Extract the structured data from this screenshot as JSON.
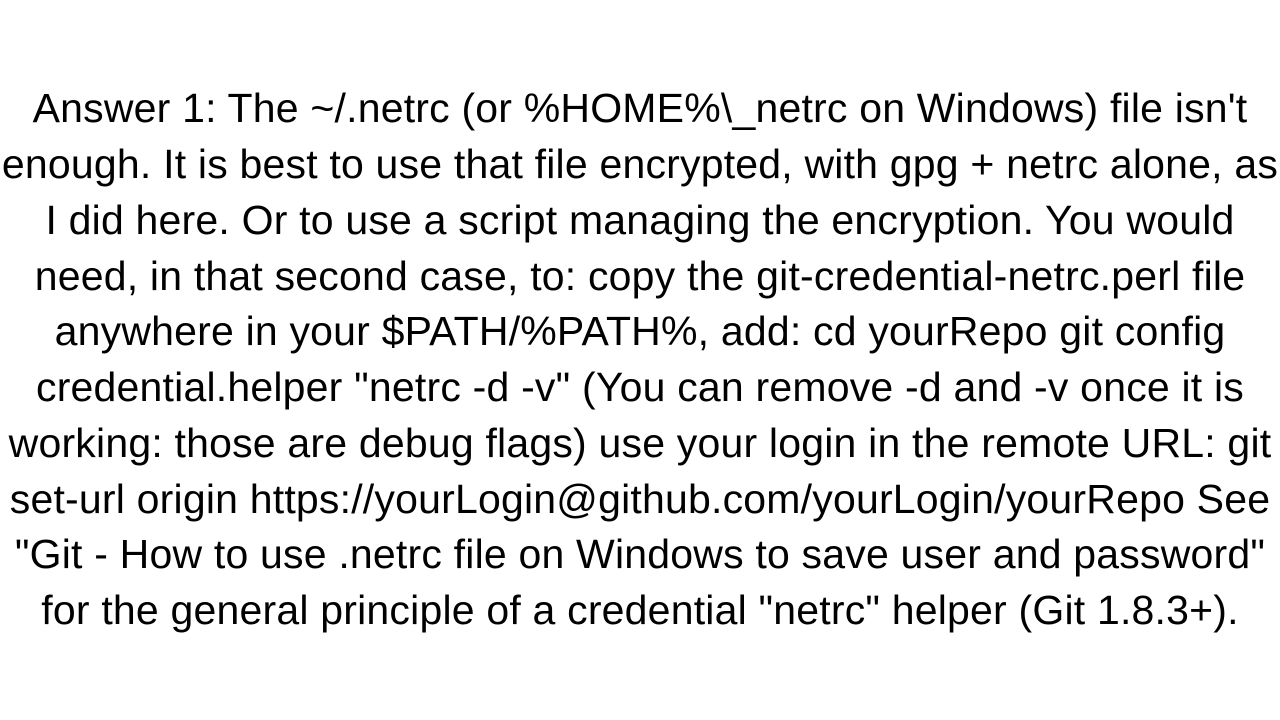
{
  "answer": {
    "text": "Answer 1: The ~/.netrc (or %HOME%\\_netrc on Windows) file isn't enough. It is best to use that file encrypted, with gpg + netrc alone, as I did here. Or to use a script managing the encryption. You would need, in that second case, to:  copy the git-credential-netrc.perl file anywhere in your $PATH/%PATH%,  add:   cd yourRepo   git config credential.helper \"netrc -d -v\"    (You can remove -d and -v once it is working: those are debug flags)  use your login in the remote URL:   git set-url origin https://yourLogin@github.com/yourLogin/yourRepo    See \"Git - How to use .netrc file on Windows to save user and password\" for the general principle of a credential \"netrc\" helper (Git 1.8.3+)."
  }
}
